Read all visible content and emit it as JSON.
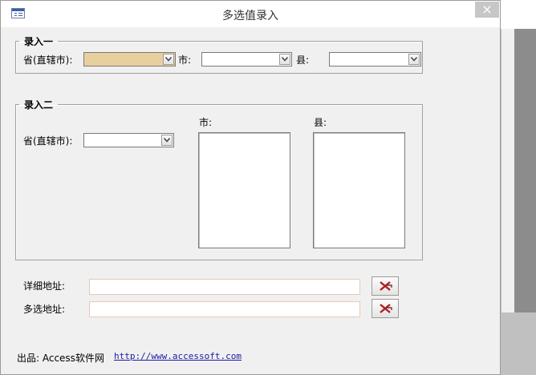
{
  "window": {
    "title": "多选值录入",
    "close_label": "×"
  },
  "group1": {
    "legend": "录入一",
    "province_label": "省(直辖市):",
    "city_label": "市:",
    "county_label": "县:",
    "province_value": "",
    "city_value": "",
    "county_value": ""
  },
  "group2": {
    "legend": "录入二",
    "province_label": "省(直辖市):",
    "province_value": "",
    "city_list_label": "市:",
    "county_list_label": "县:"
  },
  "address": {
    "detail_label": "详细地址:",
    "multi_label": "多选地址:",
    "detail_value": "",
    "multi_value": ""
  },
  "footer": {
    "credit": "出品: Access软件网",
    "link": "http://www.accessoft.com"
  },
  "colors": {
    "highlight_combo": "#e8cf9e",
    "clear_icon": "#b02020",
    "link": "#1a1aa6"
  },
  "icons": [
    "form-icon",
    "close-icon",
    "dropdown-arrow-icon",
    "clear-x-icon"
  ]
}
